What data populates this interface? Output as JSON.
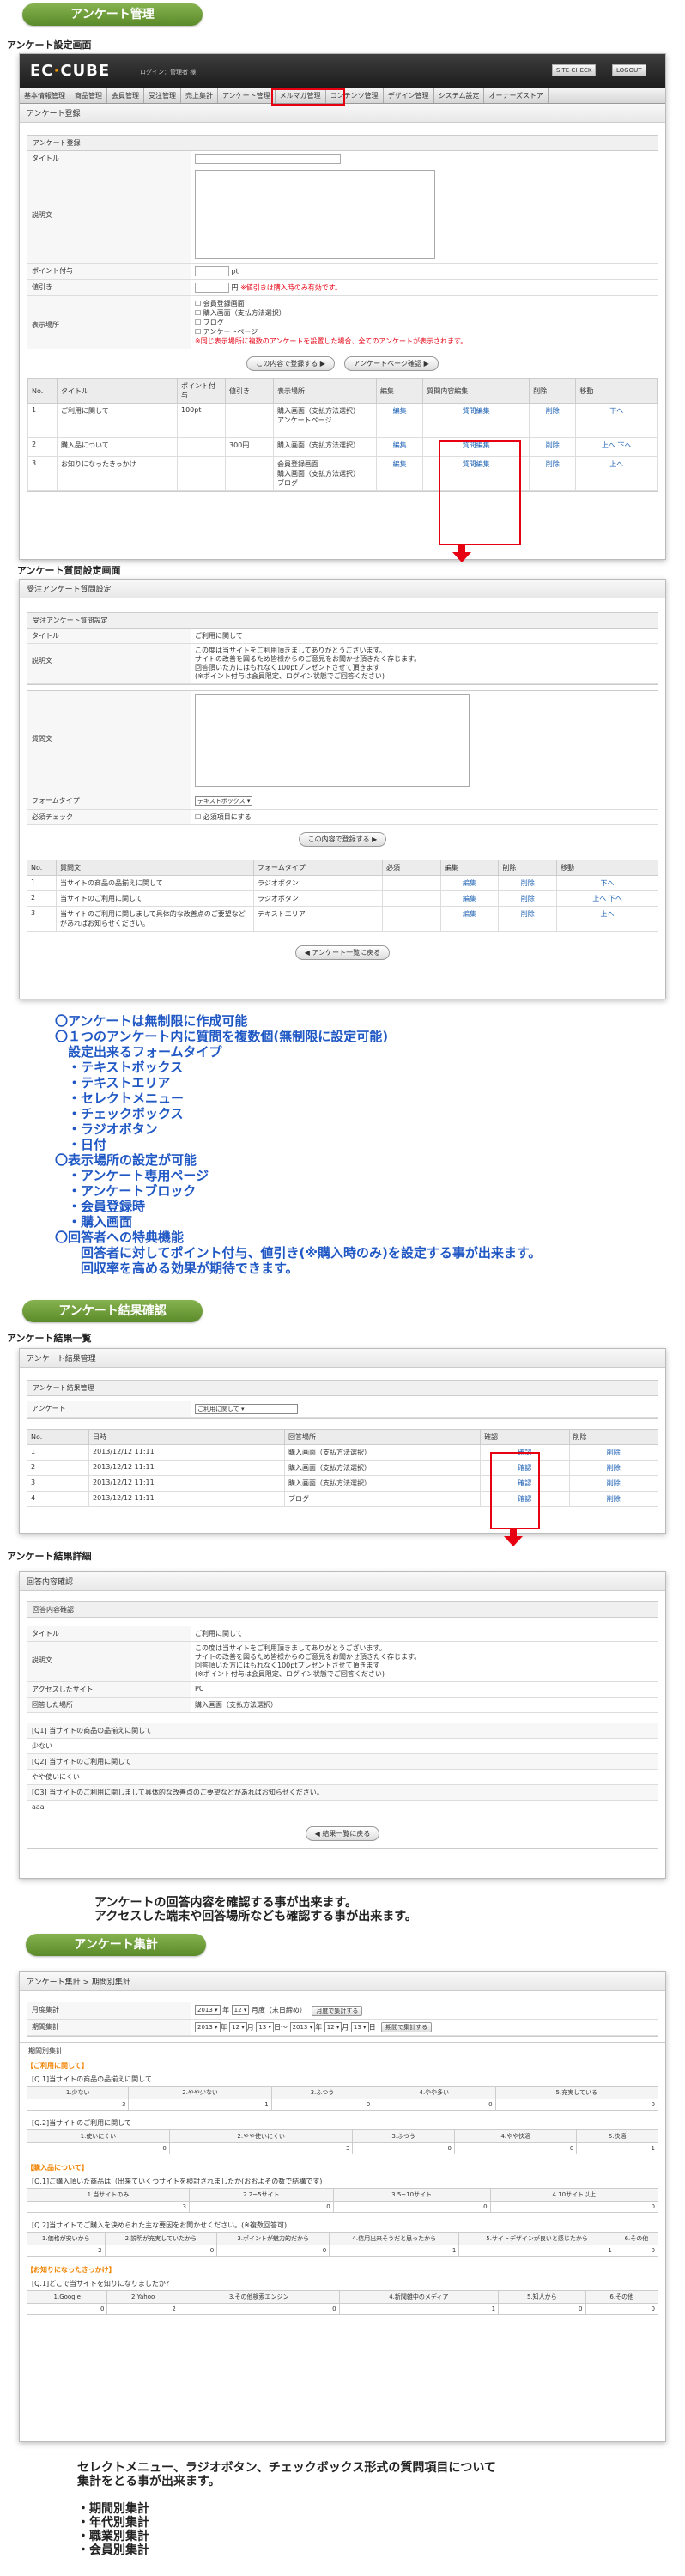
{
  "sections": {
    "enquete_admin": "アンケート管理",
    "result_check": "アンケート結果確認",
    "aggregate": "アンケート集計"
  },
  "subtitles": {
    "setting": "アンケート設定画面",
    "question": "アンケート質問設定画面",
    "result_list": "アンケート結果一覧",
    "result_detail": "アンケート結果詳細"
  },
  "header": {
    "logo_a": "EC",
    "logo_b": "CUBE",
    "login": "ログイン：管理者 様",
    "site_check": "SITE CHECK",
    "logout": "LOGOUT"
  },
  "menu": [
    "基本情報管理",
    "商品管理",
    "会員管理",
    "受注管理",
    "売上集計",
    "アンケート管理",
    "メルマガ管理",
    "コンテンツ管理",
    "デザイン管理",
    "システム設定",
    "オーナーズストア"
  ],
  "setting": {
    "page_title": "アンケート登録",
    "box_title": "アンケート登録",
    "labels": {
      "title": "タイトル",
      "desc": "説明文",
      "point": "ポイント付与",
      "discount": "値引き",
      "place": "表示場所"
    },
    "pt_unit": "pt",
    "yen_unit": "円",
    "discount_note": "※値引きは購入時のみ有効です。",
    "place_options": [
      "会員登録画面",
      "購入画面（支払方法選択）",
      "ブログ",
      "アンケートページ"
    ],
    "place_note": "※同じ表示場所に複数のアンケートを設置した場合、全てのアンケートが表示されます。",
    "btn_register": "この内容で登録する",
    "btn_confirm": "アンケートページ確認",
    "table_headers": [
      "No.",
      "タイトル",
      "ポイント付与",
      "値引き",
      "表示場所",
      "編集",
      "質問内容編集",
      "削除",
      "移動"
    ],
    "rows": [
      {
        "no": "1",
        "title": "ご利用に関して",
        "point": "100pt",
        "discount": "",
        "place": "購入画面（支払方法選択）\nアンケートページ",
        "edit": "編集",
        "qedit": "質問編集",
        "del": "削除",
        "move": "下へ"
      },
      {
        "no": "2",
        "title": "購入品について",
        "point": "",
        "discount": "300円",
        "place": "購入画面（支払方法選択）",
        "edit": "編集",
        "qedit": "質問編集",
        "del": "削除",
        "move": "上へ 下へ"
      },
      {
        "no": "3",
        "title": "お知りになったきっかけ",
        "point": "",
        "discount": "",
        "place": "会員登録画面\n購入画面（支払方法選択）\nブログ",
        "edit": "編集",
        "qedit": "質問編集",
        "del": "削除",
        "move": "上へ"
      }
    ]
  },
  "question": {
    "page_title": "受注アンケート質問設定",
    "box_title": "受注アンケート質問設定",
    "labels": {
      "title": "タイトル",
      "desc": "説明文",
      "qtext": "質問文",
      "form_type": "フォームタイプ",
      "required": "必須チェック"
    },
    "title_value": "ご利用に関して",
    "desc_value": "この度は当サイトをご利用頂きましてありがとうございます。\nサイトの改善を図るため皆様からのご意見をお聞かせ頂きたく存じます。\n回答頂いた方にはもれなく100ptプレゼントさせて頂きます\n(※ポイント付与は会員限定、ログイン状態でご回答ください)",
    "form_type_value": "テキストボックス",
    "required_label": "必須項目にする",
    "btn_register": "この内容で登録する",
    "table_headers": [
      "No.",
      "質問文",
      "フォームタイプ",
      "必須",
      "編集",
      "削除",
      "移動"
    ],
    "rows": [
      {
        "no": "1",
        "q": "当サイトの商品の品揃えに関して",
        "type": "ラジオボタン",
        "req": "",
        "edit": "編集",
        "del": "削除",
        "move": "下へ"
      },
      {
        "no": "2",
        "q": "当サイトのご利用に関して",
        "type": "ラジオボタン",
        "req": "",
        "edit": "編集",
        "del": "削除",
        "move": "上へ 下へ"
      },
      {
        "no": "3",
        "q": "当サイトのご利用に関しまして具体的な改善点のご要望などがあればお知らせください。",
        "type": "テキストエリア",
        "req": "",
        "edit": "編集",
        "del": "削除",
        "move": "上へ"
      }
    ],
    "btn_back": "アンケート一覧に戻る"
  },
  "features": "〇アンケートは無制限に作成可能\n〇１つのアンケート内に質問を複数個(無制限に設定可能)\n　設定出来るフォームタイプ\n　・テキストボックス\n　・テキストエリア\n　・セレクトメニュー\n　・チェックボックス\n　・ラジオボタン\n　・日付\n〇表示場所の設定が可能\n　・アンケート専用ページ\n　・アンケートブロック\n　・会員登録時\n　・購入画面\n〇回答者への特典機能\n　　回答者に対してポイント付与、値引き(※購入時のみ)を設定する事が出来ます。\n　　回収率を高める効果が期待できます。",
  "result_list": {
    "page_title": "アンケート結果管理",
    "box_title": "アンケート結果管理",
    "enquete_label": "アンケート",
    "enquete_value": "ご利用に関して",
    "headers": [
      "No.",
      "日時",
      "回答場所",
      "確認",
      "削除"
    ],
    "rows": [
      {
        "no": "1",
        "date": "2013/12/12 11:11",
        "place": "購入画面（支払方法選択）",
        "check": "確認",
        "del": "削除"
      },
      {
        "no": "2",
        "date": "2013/12/12 11:11",
        "place": "購入画面（支払方法選択）",
        "check": "確認",
        "del": "削除"
      },
      {
        "no": "3",
        "date": "2013/12/12 11:11",
        "place": "購入画面（支払方法選択）",
        "check": "確認",
        "del": "削除"
      },
      {
        "no": "4",
        "date": "2013/12/12 11:11",
        "place": "ブログ",
        "check": "確認",
        "del": "削除"
      }
    ]
  },
  "result_detail": {
    "page_title": "回答内容確認",
    "box_title": "回答内容確認",
    "fields": [
      {
        "label": "タイトル",
        "value": "ご利用に関して"
      },
      {
        "label": "説明文",
        "value": "この度は当サイトをご利用頂きましてありがとうございます。\nサイトの改善を図るため皆様からのご意見をお聞かせ頂きたく存じます。\n回答頂いた方にはもれなく100ptプレゼントさせて頂きます\n(※ポイント付与は会員限定、ログイン状態でご回答ください)"
      },
      {
        "label": "アクセスしたサイト",
        "value": "PC"
      },
      {
        "label": "回答した場所",
        "value": "購入画面（支払方法選択）"
      }
    ],
    "answers": [
      {
        "q": "[Q1] 当サイトの商品の品揃えに関して",
        "a": "少ない"
      },
      {
        "q": "[Q2] 当サイトのご利用に関して",
        "a": "やや使いにくい"
      },
      {
        "q": "[Q3] 当サイトのご利用に関しまして具体的な改善点のご要望などがあればお知らせください。",
        "a": "aaa"
      }
    ],
    "btn_back": "結果一覧に戻る"
  },
  "result_note": "アンケートの回答内容を確認する事が出来ます。\nアクセスした端末や回答場所なども確認する事が出来ます。",
  "aggregate": {
    "page_title": "アンケート集計 > 期間別集計",
    "monthly_label": "月度集計",
    "monthly": {
      "year": "2013",
      "year_unit": "年",
      "month": "12",
      "month_unit": "月度（末日締め）",
      "btn": "月度で集計する"
    },
    "period_label": "期間集計",
    "period": {
      "y1": "2013",
      "m1": "12",
      "d1": "13",
      "y2": "2013",
      "m2": "12",
      "d2": "13",
      "btn": "期間で集計する",
      "year_unit": "年",
      "month_unit": "月",
      "day_unit": "日",
      "tilde": "～"
    },
    "result_title": "期間別集計",
    "groups": [
      {
        "title": "【ご利用に関して】",
        "questions": [
          {
            "q": "[Q.1]当サイトの商品の品揃えに関して",
            "opts": [
              "1.少ない",
              "2.やや少ない",
              "3.ふつう",
              "4.やや多い",
              "5.充実している"
            ],
            "vals": [
              "3",
              "1",
              "0",
              "0",
              "0"
            ]
          },
          {
            "q": "[Q.2]当サイトのご利用に関して",
            "opts": [
              "1.使いにくい",
              "2.やや使いにくい",
              "3.ふつう",
              "4.やや快適",
              "5.快適"
            ],
            "vals": [
              "0",
              "3",
              "0",
              "0",
              "1"
            ]
          }
        ]
      },
      {
        "title": "【購入品について】",
        "questions": [
          {
            "q": "[Q.1]ご購入頂いた商品は（出来ていくつサイトを検討されましたか(おおよその数で結構です)",
            "opts": [
              "1.当サイトのみ",
              "2.2~5サイト",
              "3.5~10サイト",
              "4.10サイト以上"
            ],
            "vals": [
              "3",
              "0",
              "0",
              "0"
            ]
          },
          {
            "q": "[Q.2]当サイトでご購入を決められた主な要因をお聞かせください。(※複数回答可)",
            "opts": [
              "1.価格が安いから",
              "2.説明が充実していたから",
              "3.ポイントが魅力的だから",
              "4.信用出来そうだと思ったから",
              "5.サイトデザインが良いと感じたから",
              "6.その他"
            ],
            "vals": [
              "2",
              "0",
              "0",
              "1",
              "1",
              "0"
            ]
          }
        ]
      },
      {
        "title": "【お知りになったきっかけ】",
        "questions": [
          {
            "q": "[Q.1]どこで当サイトを知りになりましたか?",
            "opts": [
              "1.Google",
              "2.Yahoo",
              "3.その他検索エンジン",
              "4.新聞雑中のメディア",
              "5.知人から",
              "6.その他"
            ],
            "vals": [
              "0",
              "2",
              "0",
              "1",
              "0",
              "0"
            ]
          }
        ]
      }
    ]
  },
  "aggregate_note": "セレクトメニュー、ラジオボタン、チェックボックス形式の質問項目について\n集計をとる事が出来ます。\n\n・期間別集計\n・年代別集計\n・職業別集計\n・会員別集計"
}
